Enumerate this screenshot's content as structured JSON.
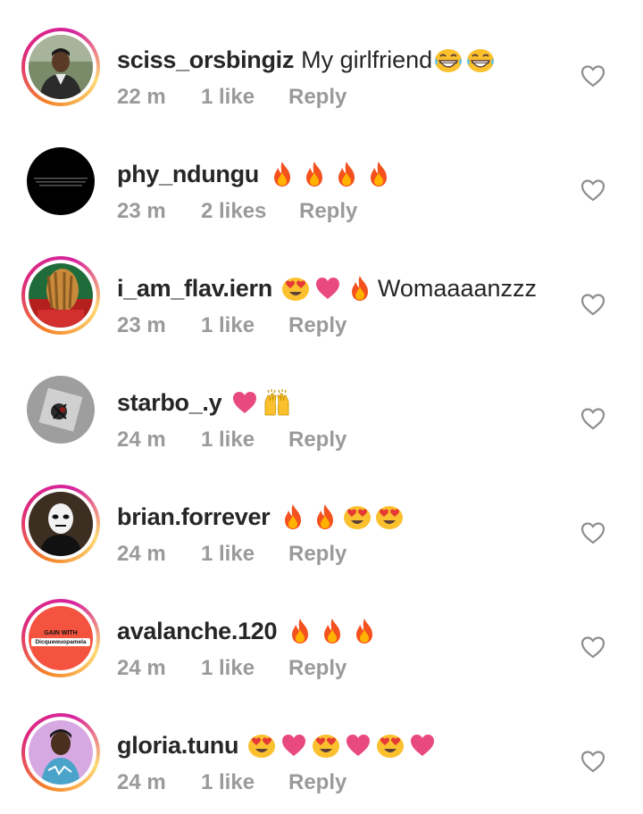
{
  "comments": [
    {
      "username": "sciss_orsbingiz",
      "text": "My girlfriend",
      "emojis": [
        "grin",
        "grin"
      ],
      "time": "22 m",
      "likes": "1 like",
      "reply": "Reply",
      "avatar": "photo-man"
    },
    {
      "username": "phy_ndungu",
      "text": "",
      "emojis": [
        "fire",
        "fire",
        "fire",
        "fire"
      ],
      "time": "23 m",
      "likes": "2 likes",
      "reply": "Reply",
      "avatar": "black-text"
    },
    {
      "username": "i_am_flav.iern",
      "text": "Womaaaanzzz",
      "emojis": [
        "heart-eyes",
        "heart",
        "fire"
      ],
      "time": "23 m",
      "likes": "1 like",
      "reply": "Reply",
      "avatar": "photo-braids"
    },
    {
      "username": "starbo_.y",
      "text": "",
      "emojis": [
        "heart",
        "raised-hands"
      ],
      "time": "24 m",
      "likes": "1 like",
      "reply": "Reply",
      "avatar": "grey-rose"
    },
    {
      "username": "brian.forrever",
      "text": "",
      "emojis": [
        "fire",
        "fire",
        "heart-eyes",
        "heart-eyes"
      ],
      "time": "24 m",
      "likes": "1 like",
      "reply": "Reply",
      "avatar": "mask"
    },
    {
      "username": "avalanche.120",
      "text": "",
      "emojis": [
        "fire",
        "fire",
        "fire"
      ],
      "time": "24 m",
      "likes": "1 like",
      "reply": "Reply",
      "avatar": "gain-with",
      "avatar_text": [
        "GAIN WITH",
        "Dicquewuopamela"
      ]
    },
    {
      "username": "gloria.tunu",
      "text": "",
      "emojis": [
        "heart-eyes",
        "heart",
        "heart-eyes",
        "heart",
        "heart-eyes",
        "heart"
      ],
      "time": "24 m",
      "likes": "1 like",
      "reply": "Reply",
      "avatar": "photo-woman"
    }
  ],
  "icons": {
    "like": "heart-outline-icon"
  },
  "colors": {
    "username": "#262626",
    "meta": "#9a9a9a",
    "heart_emoji": "#e84a7f",
    "fire": "#f4511e",
    "emoji_face": "#fbc02d"
  }
}
